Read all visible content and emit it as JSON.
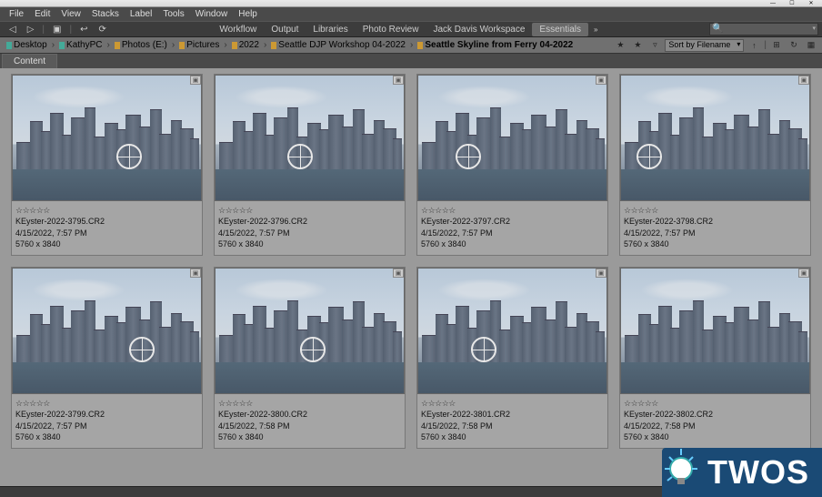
{
  "menu": {
    "items": [
      "File",
      "Edit",
      "View",
      "Stacks",
      "Label",
      "Tools",
      "Window",
      "Help"
    ]
  },
  "workspaces": {
    "items": [
      "Workflow",
      "Output",
      "Libraries",
      "Photo Review",
      "Jack Davis Workspace",
      "Essentials"
    ],
    "active": "Essentials"
  },
  "toolbar": {
    "back_icon": "◁",
    "fwd_icon": "▷",
    "reveal_icon": "▣",
    "boomerang_icon": "↩",
    "refresh_icon": "⟳"
  },
  "breadcrumb": {
    "items": [
      {
        "label": "Desktop",
        "kind": "desktop"
      },
      {
        "label": "KathyPC",
        "kind": "pc"
      },
      {
        "label": "Photos (E:)",
        "kind": "drive"
      },
      {
        "label": "Pictures",
        "kind": "folder"
      },
      {
        "label": "2022",
        "kind": "folder"
      },
      {
        "label": "Seattle DJP Workshop 04-2022",
        "kind": "folder"
      },
      {
        "label": "Seattle Skyline from Ferry 04-2022",
        "kind": "folder",
        "current": true
      }
    ]
  },
  "rightbar": {
    "filter_star_icon": "★",
    "filter_star2_icon": "★",
    "filter_funnel_icon": "▿",
    "sort_label": "Sort by Filename",
    "sort_asc_icon": "↑",
    "new_folder_icon": "⊞",
    "open_recent_icon": "↻",
    "thumb_icon": "▦"
  },
  "content_tab": {
    "label": "Content"
  },
  "thumbnails": [
    {
      "filename": "KEyster-2022-3795.CR2",
      "datetime": "4/15/2022, 7:57 PM",
      "dimensions": "5760 x 3840",
      "rating_display": "☆☆☆☆☆",
      "ferris_left": "55%"
    },
    {
      "filename": "KEyster-2022-3796.CR2",
      "datetime": "4/15/2022, 7:57 PM",
      "dimensions": "5760 x 3840",
      "rating_display": "☆☆☆☆☆",
      "ferris_left": "38%"
    },
    {
      "filename": "KEyster-2022-3797.CR2",
      "datetime": "4/15/2022, 7:57 PM",
      "dimensions": "5760 x 3840",
      "rating_display": "☆☆☆☆☆",
      "ferris_left": "20%"
    },
    {
      "filename": "KEyster-2022-3798.CR2",
      "datetime": "4/15/2022, 7:57 PM",
      "dimensions": "5760 x 3840",
      "rating_display": "☆☆☆☆☆",
      "ferris_left": "8%"
    },
    {
      "filename": "KEyster-2022-3799.CR2",
      "datetime": "4/15/2022, 7:57 PM",
      "dimensions": "5760 x 3840",
      "rating_display": "☆☆☆☆☆",
      "ferris_left": "62%"
    },
    {
      "filename": "KEyster-2022-3800.CR2",
      "datetime": "4/15/2022, 7:58 PM",
      "dimensions": "5760 x 3840",
      "rating_display": "☆☆☆☆☆",
      "ferris_left": "45%"
    },
    {
      "filename": "KEyster-2022-3801.CR2",
      "datetime": "4/15/2022, 7:58 PM",
      "dimensions": "5760 x 3840",
      "rating_display": "☆☆☆☆☆",
      "ferris_left": "28%"
    },
    {
      "filename": "KEyster-2022-3802.CR2",
      "datetime": "4/15/2022, 7:58 PM",
      "dimensions": "5760 x 3840",
      "rating_display": "☆☆☆☆☆",
      "ferris_left": "none"
    }
  ],
  "watermark": {
    "text": "TWOS"
  }
}
